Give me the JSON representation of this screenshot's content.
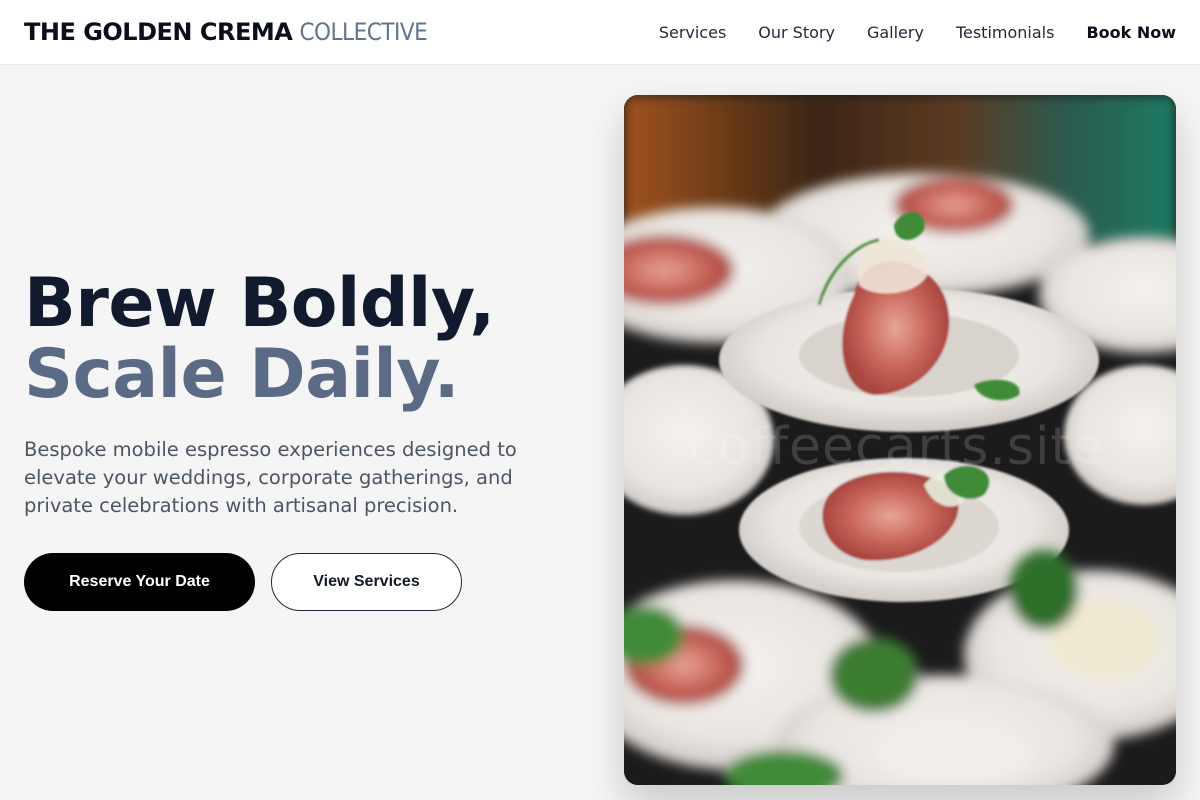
{
  "brand": {
    "strong": "THE GOLDEN CREMA",
    "light": "COLLECTIVE"
  },
  "nav": {
    "items": [
      "Services",
      "Our Story",
      "Gallery",
      "Testimonials"
    ],
    "cta": "Book Now"
  },
  "hero": {
    "headline_line1": "Brew Boldly,",
    "headline_line2": "Scale Daily.",
    "subtext": "Bespoke mobile espresso experiences designed to elevate your weddings, corporate gatherings, and private celebrations with artisanal precision.",
    "primary_button": "Reserve Your Date",
    "secondary_button": "View Services"
  },
  "photo": {
    "watermark": "coffeecarts.site",
    "subject": "plates-of-prosciutto-with-microgreens"
  },
  "colors": {
    "headline_dark": "#121a2e",
    "headline_muted": "#5b6b86",
    "primary_button_bg": "#000000",
    "page_bg": "#f5f5f5"
  }
}
